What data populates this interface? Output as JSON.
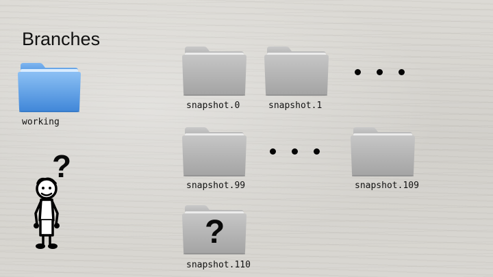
{
  "slide": {
    "title": "Branches",
    "working_folder": {
      "label": "working",
      "icon": "blue-folder-icon",
      "color": "#5ea2ea"
    },
    "snapshots": [
      {
        "label": "snapshot.0"
      },
      {
        "label": "snapshot.1"
      },
      {
        "label": "snapshot.99"
      },
      {
        "label": "snapshot.109"
      },
      {
        "label": "snapshot.110",
        "overlay": "?"
      }
    ],
    "ellipsis": [
      "•",
      "•",
      "•"
    ],
    "person": {
      "icon": "stick-figure-confused-icon",
      "question_mark": "?"
    },
    "colors": {
      "folder_gray": "#b9b9b9",
      "text": "#111111"
    }
  }
}
